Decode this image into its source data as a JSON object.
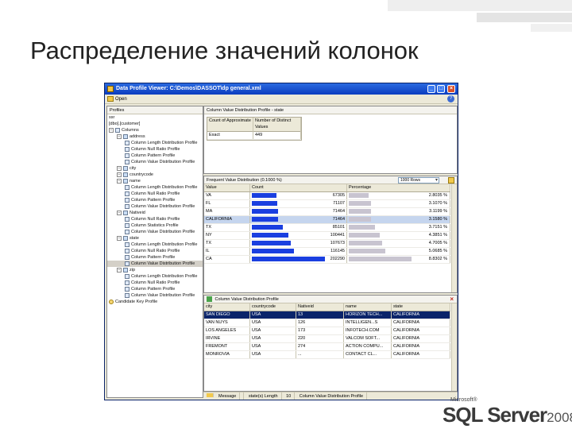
{
  "slide": {
    "title": "Распределение значений колонок",
    "logo_brand": "Microsoft®",
    "logo_product": "SQL Server",
    "logo_version": "2008"
  },
  "window": {
    "title": "Data Profile Viewer: C:\\Demos\\DASSOT\\dp general.xml",
    "toolbar_open": "Open"
  },
  "profiles_panel": {
    "header": "Profiles",
    "items": [
      {
        "label": "ssr",
        "indent": 0,
        "icon": "none"
      },
      {
        "label": "[dbo].[customer]",
        "indent": 0,
        "icon": "none"
      },
      {
        "label": "Columns",
        "indent": 0,
        "icon": "folder"
      },
      {
        "label": "address",
        "indent": 1,
        "icon": "column"
      },
      {
        "label": "Column Length Distribution Profile",
        "indent": 2,
        "icon": "profile"
      },
      {
        "label": "Column Null Ratio Profile",
        "indent": 2,
        "icon": "profile"
      },
      {
        "label": "Column Pattern Profile",
        "indent": 2,
        "icon": "profile"
      },
      {
        "label": "Column Value Distribution Profile",
        "indent": 2,
        "icon": "profile"
      },
      {
        "label": "city",
        "indent": 1,
        "icon": "column"
      },
      {
        "label": "countrycode",
        "indent": 1,
        "icon": "column"
      },
      {
        "label": "name",
        "indent": 1,
        "icon": "column"
      },
      {
        "label": "Column Length Distribution Profile",
        "indent": 2,
        "icon": "profile"
      },
      {
        "label": "Column Null Ratio Profile",
        "indent": 2,
        "icon": "profile"
      },
      {
        "label": "Column Pattern Profile",
        "indent": 2,
        "icon": "profile"
      },
      {
        "label": "Column Value Distribution Profile",
        "indent": 2,
        "icon": "profile"
      },
      {
        "label": "Nativeid",
        "indent": 1,
        "icon": "column"
      },
      {
        "label": "Column Null Ratio Profile",
        "indent": 2,
        "icon": "profile"
      },
      {
        "label": "Column Statistics Profile",
        "indent": 2,
        "icon": "profile"
      },
      {
        "label": "Column Value Distribution Profile",
        "indent": 2,
        "icon": "profile"
      },
      {
        "label": "state",
        "indent": 1,
        "icon": "column"
      },
      {
        "label": "Column Length Distribution Profile",
        "indent": 2,
        "icon": "profile"
      },
      {
        "label": "Column Null Ratio Profile",
        "indent": 2,
        "icon": "profile"
      },
      {
        "label": "Column Pattern Profile",
        "indent": 2,
        "icon": "profile"
      },
      {
        "label": "Column Value Distribution Profile",
        "indent": 2,
        "icon": "profile",
        "selected": true
      },
      {
        "label": "zip",
        "indent": 1,
        "icon": "column"
      },
      {
        "label": "Column Length Distribution Profile",
        "indent": 2,
        "icon": "profile"
      },
      {
        "label": "Column Null Ratio Profile",
        "indent": 2,
        "icon": "profile"
      },
      {
        "label": "Column Pattern Profile",
        "indent": 2,
        "icon": "profile"
      },
      {
        "label": "Column Value Distribution Profile",
        "indent": 2,
        "icon": "profile"
      },
      {
        "label": "Candidate Key Profile",
        "indent": 0,
        "icon": "key"
      }
    ]
  },
  "summary_panel": {
    "header": "Column Value Distribution Profile - state",
    "col1": "Count of Approximate",
    "col2": "Number of Distinct Values",
    "rows": [
      [
        "Exact",
        "449"
      ]
    ]
  },
  "distribution_panel": {
    "header": "Frequent Value Distribution (0.1000 %)",
    "rows_combo": "1000 Rows",
    "columns": [
      "Value",
      "Count",
      "Percentage"
    ],
    "rows": [
      {
        "value": "VA",
        "count": "67305",
        "percent": "2.8035 %",
        "count_num": 67305,
        "pct_num": 2.8035
      },
      {
        "value": "FL",
        "count": "71107",
        "percent": "3.1070 %",
        "count_num": 71107,
        "pct_num": 3.107
      },
      {
        "value": "MA",
        "count": "71464",
        "percent": "3.1199 %",
        "count_num": 71464,
        "pct_num": 3.1199
      },
      {
        "value": "CALIFORNIA",
        "count": "71464",
        "percent": "3.1580 %",
        "count_num": 71464,
        "pct_num": 3.158,
        "selected": true
      },
      {
        "value": "TX",
        "count": "85101",
        "percent": "3.7151 %",
        "count_num": 85101,
        "pct_num": 3.7151
      },
      {
        "value": "NY",
        "count": "100441",
        "percent": "4.3851 %",
        "count_num": 100441,
        "pct_num": 4.3851
      },
      {
        "value": "TX",
        "count": "107673",
        "percent": "4.7005 %",
        "count_num": 107673,
        "pct_num": 4.7005
      },
      {
        "value": "IL",
        "count": "116145",
        "percent": "5.0685 %",
        "count_num": 116145,
        "pct_num": 5.0685
      },
      {
        "value": "CA",
        "count": "202290",
        "percent": "8.8302 %",
        "count_num": 202290,
        "pct_num": 8.8302
      }
    ]
  },
  "drill_panel": {
    "header": "Column Value Distribution Profile",
    "columns": [
      "city",
      "countrycode",
      "Nativeid",
      "name",
      "state"
    ],
    "rows": [
      [
        "SAN DIEGO",
        "USA",
        "13",
        "HORIZON TECH...",
        "CALIFORNIA"
      ],
      [
        "VAN NUYS",
        "USA",
        "126",
        "INTELLIGEN...S",
        "CALIFORNIA"
      ],
      [
        "LOS ANGELES",
        "USA",
        "173",
        "INFOTECH.COM",
        "CALIFORNIA"
      ],
      [
        "IRVINE",
        "USA",
        "220",
        "VALCOM SOFT...",
        "CALIFORNIA"
      ],
      [
        "FREMONT",
        "USA",
        "274",
        "ACTION COMPU...",
        "CALIFORNIA"
      ],
      [
        "MONROVIA",
        "USA",
        "...",
        "CONTACT CL...",
        "CALIFORNIA"
      ]
    ]
  },
  "statusbar": {
    "message": "Message",
    "metric": "state(s) Length",
    "metric_value": "10",
    "profile": "Column Value Distribution Profile"
  }
}
